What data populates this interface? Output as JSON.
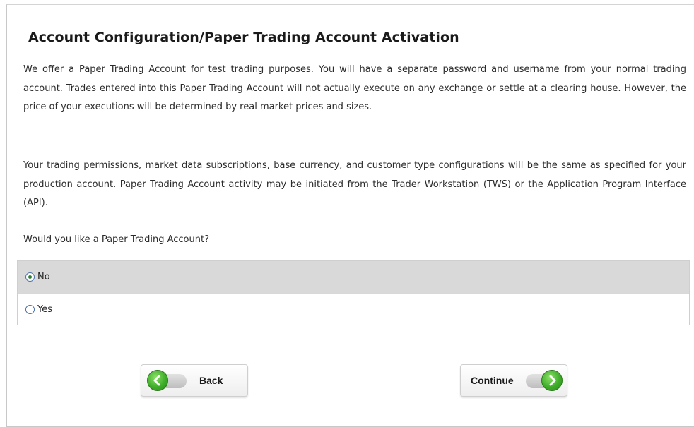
{
  "page": {
    "title": "Account Configuration/Paper Trading Account Activation",
    "paragraph_1": "We offer a Paper Trading Account for test trading purposes. You will have a separate password and username from your normal trading account. Trades entered into this Paper Trading Account will not actually execute on any exchange or settle at a clearing house. However, the price of your executions will be determined by real market prices and sizes.",
    "paragraph_2": "Your trading permissions, market data subscriptions, base currency, and customer type configurations will be the same as specified for your production account. Paper Trading Account activity may be initiated from the Trader Workstation (TWS) or the Application Program Interface (API).",
    "question": "Would you like a Paper Trading Account?"
  },
  "options": {
    "selected": "No",
    "no_label": "No",
    "yes_label": "Yes"
  },
  "buttons": {
    "back_label": "Back",
    "continue_label": "Continue"
  },
  "colors": {
    "selected_row": "#d9d9d9",
    "button_icon_green": "#3fae2a"
  },
  "icons": {
    "back": "arrow-left-circle-icon",
    "continue": "arrow-right-circle-icon",
    "radio_selected": "radio-checked-icon",
    "radio_unselected": "radio-unchecked-icon"
  }
}
